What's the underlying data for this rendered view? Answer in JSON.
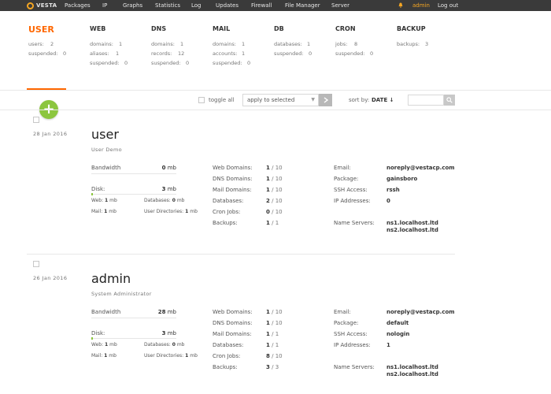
{
  "app": {
    "logo_text": "VESTA"
  },
  "nav": [
    "Packages",
    "IP",
    "Graphs",
    "Statistics",
    "Log",
    "Updates",
    "Firewall",
    "File Manager",
    "Server"
  ],
  "topbar": {
    "user": "admin",
    "logout": "Log out"
  },
  "stats": {
    "user": {
      "title": "USER",
      "rows": [
        {
          "label": "users:",
          "value": "2"
        },
        {
          "label": "suspended:",
          "value": "0"
        }
      ]
    },
    "web": {
      "title": "WEB",
      "rows": [
        {
          "label": "domains:",
          "value": "1"
        },
        {
          "label": "aliases:",
          "value": "1"
        },
        {
          "label": "suspended:",
          "value": "0"
        }
      ]
    },
    "dns": {
      "title": "DNS",
      "rows": [
        {
          "label": "domains:",
          "value": "1"
        },
        {
          "label": "records:",
          "value": "12"
        },
        {
          "label": "suspended:",
          "value": "0"
        }
      ]
    },
    "mail": {
      "title": "MAIL",
      "rows": [
        {
          "label": "domains:",
          "value": "1"
        },
        {
          "label": "accounts:",
          "value": "1"
        },
        {
          "label": "suspended:",
          "value": "0"
        }
      ]
    },
    "db": {
      "title": "DB",
      "rows": [
        {
          "label": "databases:",
          "value": "1"
        },
        {
          "label": "suspended:",
          "value": "0"
        }
      ]
    },
    "cron": {
      "title": "CRON",
      "rows": [
        {
          "label": "jobs:",
          "value": "8"
        },
        {
          "label": "suspended:",
          "value": "0"
        }
      ]
    },
    "backup": {
      "title": "BACKUP",
      "rows": [
        {
          "label": "backups:",
          "value": "3"
        }
      ]
    }
  },
  "toolbar": {
    "toggle_all": "toggle all",
    "apply_selected": "apply to selected",
    "sort_by": "sort by:",
    "sort_value": "DATE ↓",
    "search_placeholder": ""
  },
  "labels": {
    "bandwidth": "Bandwidth",
    "disk": "Disk:",
    "web": "Web:",
    "mail": "Mail:",
    "databases": "Databases:",
    "user_dirs": "User Directories:",
    "mb": "mb",
    "web_domains": "Web Domains:",
    "dns_domains": "DNS Domains:",
    "mail_domains": "Mail Domains:",
    "dbs": "Databases:",
    "cron_jobs": "Cron Jobs:",
    "backups": "Backups:",
    "email": "Email:",
    "package": "Package:",
    "ssh": "SSH Access:",
    "ip": "IP Addresses:",
    "ns": "Name Servers:",
    "slash": "/"
  },
  "users": [
    {
      "date": "28  Jan  2016",
      "name": "user",
      "full_name": "User Demo",
      "bandwidth": "0",
      "bandwidth_fraction": 0,
      "disk": "3",
      "disk_fraction": 0.02,
      "disk_web": "1",
      "disk_databases": "0",
      "disk_mail": "1",
      "disk_user_dirs": "1",
      "web_domains": {
        "used": "1",
        "limit": "10"
      },
      "dns_domains": {
        "used": "1",
        "limit": "10"
      },
      "mail_domains": {
        "used": "1",
        "limit": "10"
      },
      "databases": {
        "used": "2",
        "limit": "10"
      },
      "cron_jobs": {
        "used": "0",
        "limit": "10"
      },
      "backups": {
        "used": "1",
        "limit": "1"
      },
      "email": "noreply@vestacp.com",
      "package": "gainsboro",
      "ssh": "rssh",
      "ip": "0",
      "ns1": "ns1.localhost.ltd",
      "ns2": "ns2.localhost.ltd"
    },
    {
      "date": "26  Jan  2016",
      "name": "admin",
      "full_name": "System Administrator",
      "bandwidth": "28",
      "bandwidth_fraction": 0,
      "disk": "3",
      "disk_fraction": 0.02,
      "disk_web": "1",
      "disk_databases": "0",
      "disk_mail": "1",
      "disk_user_dirs": "1",
      "web_domains": {
        "used": "1",
        "limit": "10"
      },
      "dns_domains": {
        "used": "1",
        "limit": "10"
      },
      "mail_domains": {
        "used": "1",
        "limit": "1"
      },
      "databases": {
        "used": "1",
        "limit": "1"
      },
      "cron_jobs": {
        "used": "8",
        "limit": "10"
      },
      "backups": {
        "used": "3",
        "limit": "3"
      },
      "email": "noreply@vestacp.com",
      "package": "default",
      "ssh": "nologin",
      "ip": "1",
      "ns1": "ns1.localhost.ltd",
      "ns2": "ns2.localhost.ltd"
    }
  ],
  "colors": {
    "accent": "#ff6701",
    "topbar": "#3a3a3a",
    "add": "#8cc63f",
    "admin": "#f5a623"
  }
}
